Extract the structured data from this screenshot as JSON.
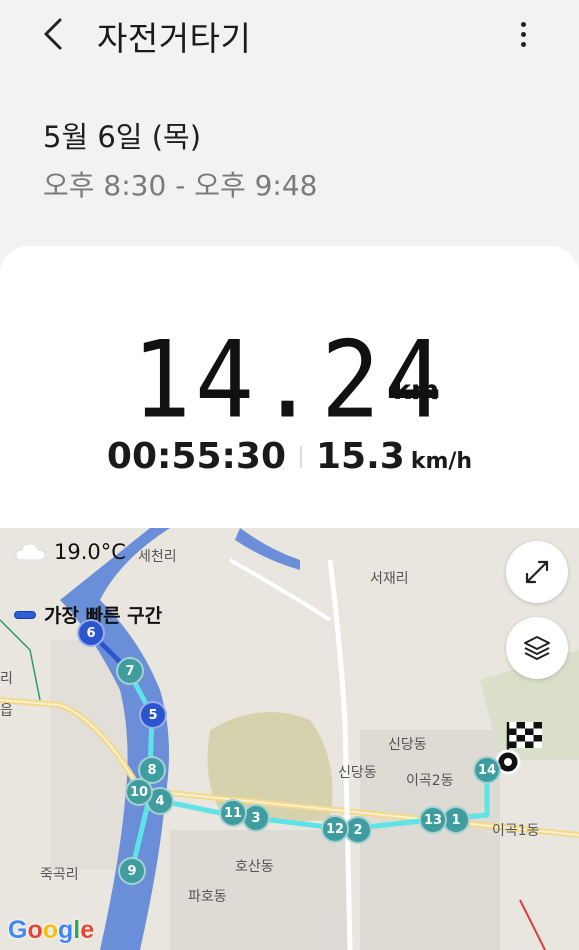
{
  "header": {
    "title": "자전거타기",
    "back_icon": "chevron-left-icon",
    "more_icon": "more-vertical-icon"
  },
  "workout": {
    "date": "5월 6일 (목)",
    "time_range": "오후 8:30 - 오후 9:48",
    "distance": "14.24",
    "distance_unit": "km",
    "duration": "00:55:30",
    "avg_speed": "15.3",
    "speed_unit": "km/h"
  },
  "map": {
    "weather": "19.0°C",
    "weather_icon": "cloud-icon",
    "legend_label": "가장 빠른 구간",
    "expand_icon": "expand-icon",
    "layers_icon": "layers-icon",
    "attribution": "Google",
    "route_color": "#5ee3e6",
    "fast_segment_color": "#2b55cf",
    "places": [
      "세천리",
      "서재리",
      "신당동",
      "신당동",
      "이곡2동",
      "이곡1동",
      "호산동",
      "죽곡리",
      "파호동",
      "리",
      "읍"
    ],
    "markers": [
      "1",
      "2",
      "3",
      "4",
      "5",
      "6",
      "7",
      "8",
      "9",
      "10",
      "11",
      "12",
      "13",
      "14"
    ]
  }
}
